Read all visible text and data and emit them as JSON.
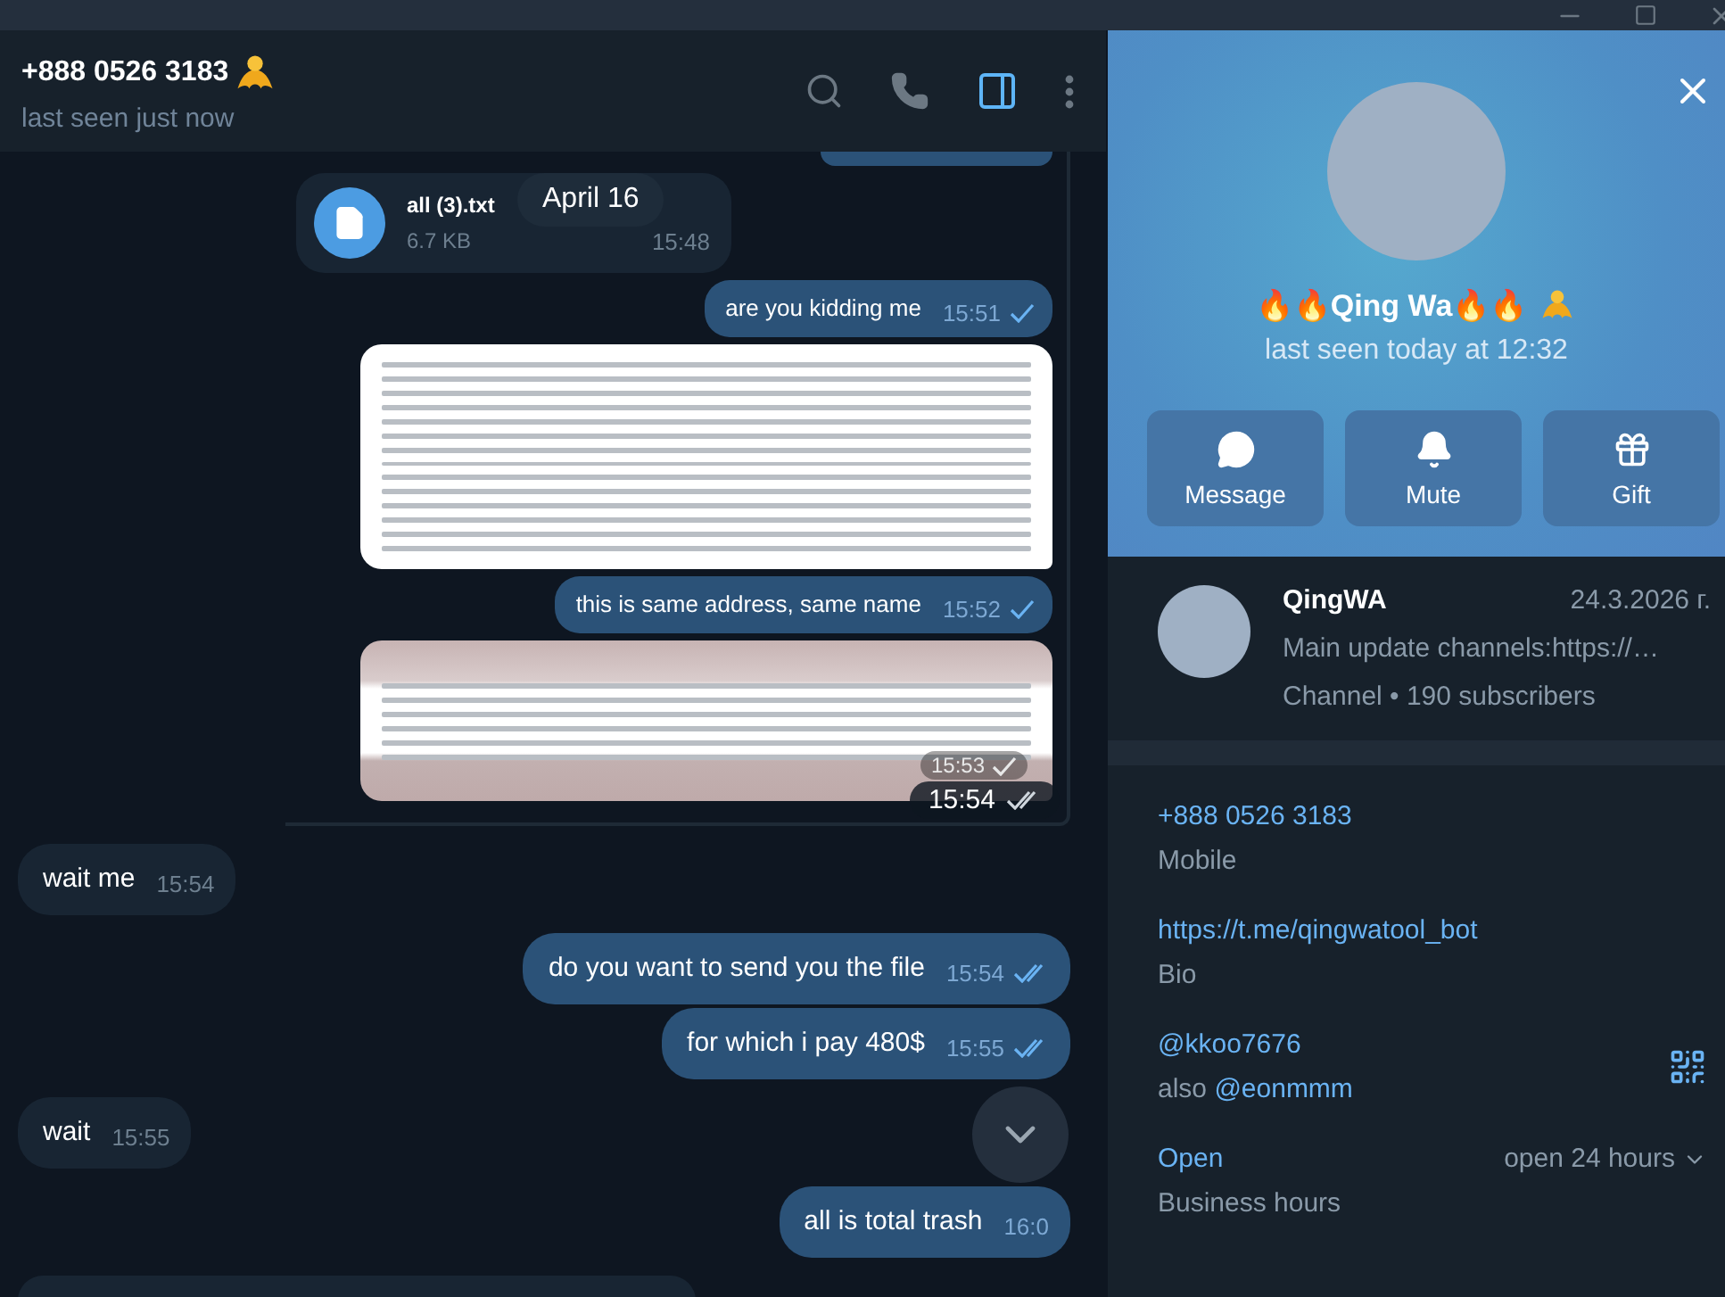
{
  "chat": {
    "header": {
      "title": "+888 0526 3183",
      "status": "last seen just now",
      "profile_panel_open": true
    },
    "date_badge": "April 16",
    "top_messages": [
      {
        "kind": "stub",
        "outgoing": true
      },
      {
        "kind": "file",
        "outgoing": false,
        "filename": "all (3).txt",
        "size": "6.7 KB",
        "time": "15:48"
      },
      {
        "kind": "text",
        "outgoing": true,
        "text": "are you kidding me",
        "time": "15:51",
        "read": false
      },
      {
        "kind": "photo",
        "outgoing": true
      },
      {
        "kind": "text",
        "outgoing": true,
        "text": "this is same address, same name",
        "time": "15:52",
        "read": false
      },
      {
        "kind": "photo",
        "outgoing": true,
        "time": "15:53",
        "read": false
      }
    ],
    "group_time": {
      "time": "15:54",
      "read": true
    },
    "messages": [
      {
        "kind": "text",
        "outgoing": false,
        "text": "wait me",
        "time": "15:54"
      },
      {
        "kind": "text",
        "outgoing": true,
        "text": "do you want to send you the file",
        "time": "15:54",
        "read": true
      },
      {
        "kind": "text",
        "outgoing": true,
        "text": "for which i pay 480$",
        "time": "15:55",
        "read": true
      },
      {
        "kind": "text",
        "outgoing": false,
        "text": "wait",
        "time": "15:55"
      },
      {
        "kind": "text",
        "outgoing": true,
        "text": "all is total trash",
        "time": "16:0"
      },
      {
        "kind": "stub",
        "outgoing": false
      }
    ]
  },
  "profile": {
    "name": "🔥🔥Qing Wa🔥🔥",
    "status": "last seen today at 12:32",
    "actions": [
      {
        "kind": "message",
        "label": "Message"
      },
      {
        "kind": "mute",
        "label": "Mute"
      },
      {
        "kind": "gift",
        "label": "Gift"
      }
    ],
    "channel": {
      "name": "QingWA",
      "date": "24.3.2026 г.",
      "preview": "Main update channels:https://…",
      "meta": "Channel • 190 subscribers"
    },
    "info": [
      {
        "kind": "phone",
        "value": "+888 0526 3183",
        "label": "Mobile"
      },
      {
        "kind": "bio",
        "value": "https://t.me/qingwatool_bot",
        "label": "Bio"
      },
      {
        "kind": "username",
        "value": "@kkoo7676",
        "label": "also ",
        "label_link": "@eonmmm"
      },
      {
        "kind": "hours",
        "value": "Open",
        "label": "Business hours",
        "right": "open 24 hours"
      }
    ]
  }
}
